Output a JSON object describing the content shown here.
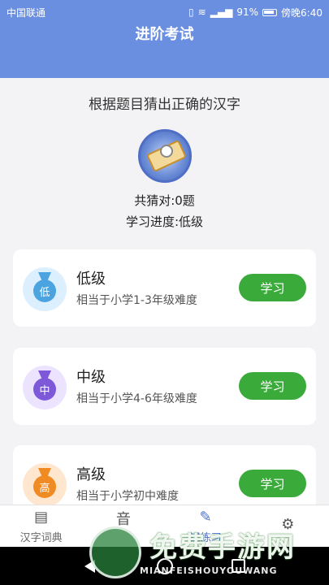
{
  "status": {
    "carrier": "中国联通",
    "battery": "91%",
    "time": "傍晚6:40"
  },
  "header": {
    "title": "进阶考试"
  },
  "main": {
    "prompt": "根据题目猜出正确的汉字",
    "correct_count": "共猜对:0题",
    "progress": "学习进度:低级"
  },
  "levels": [
    {
      "badge": "低",
      "name": "低级",
      "desc": "相当于小学1-3年级难度",
      "button": "学习",
      "color": "#4ba3e0",
      "bg": "#dcefff"
    },
    {
      "badge": "中",
      "name": "中级",
      "desc": "相当于小学4-6年级难度",
      "button": "学习",
      "color": "#7d58d8",
      "bg": "#ece4ff"
    },
    {
      "badge": "高",
      "name": "高级",
      "desc": "相当于小学初中难度",
      "button": "学习",
      "color": "#f08a22",
      "bg": "#ffe7cf"
    }
  ],
  "tabs": [
    {
      "label": "汉字词典",
      "icon": "dictionary-icon"
    },
    {
      "label": "音",
      "icon": "pinyin-icon"
    },
    {
      "label": "课练习",
      "icon": "guess-icon"
    },
    {
      "label": "",
      "icon": "gear-icon"
    }
  ],
  "watermark": {
    "title": "免费手游网",
    "url": "MIANFEISHOUYOUWANG"
  }
}
